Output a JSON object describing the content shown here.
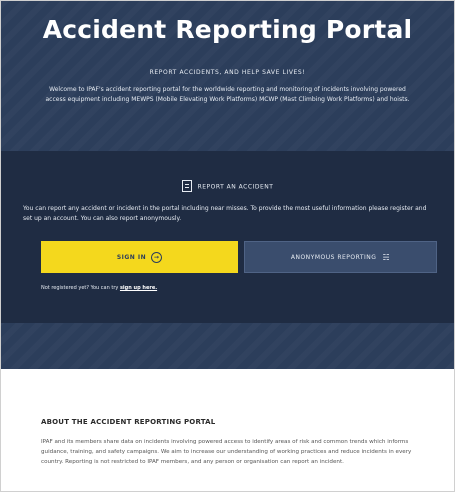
{
  "hero": {
    "title": "Accident Reporting Portal",
    "tagline": "REPORT ACCIDENTS, AND HELP SAVE LIVES!",
    "intro": "Welcome to IPAF's accident reporting portal for the worldwide reporting and monitoring of incidents involving powered access equipment including MEWPS (Mobile Elevating Work Platforms) MCWP (Mast Climbing Work Platforms) and hoists."
  },
  "report": {
    "heading": "REPORT AN ACCIDENT",
    "description": "You can report any accident or incident in the portal including near misses. To provide the most useful information please register and set up an account. You can also report anonymously.",
    "signin_label": "SIGN IN",
    "anonymous_label": "ANONYMOUS REPORTING",
    "register_prefix": "Not registered yet? You can try",
    "register_link": "sign up here."
  },
  "about": {
    "heading": "ABOUT THE ACCIDENT REPORTING PORTAL",
    "body": "IPAF and its members share data on incidents involving powered access to identify areas of risk and common trends which informs guidance, training, and safety campaigns. We aim to increase our understanding of working practices and reduce incidents in every country. Reporting is not restricted to IPAF members, and any person or organisation can report an incident."
  },
  "icons": {
    "report": "document-icon",
    "signin": "sign-in-arrow-icon",
    "anonymous": "incognito-icon"
  },
  "colors": {
    "hero_bg": "#2c3e5b",
    "panel_bg": "#1f2c43",
    "signin_button": "#f4d81d",
    "anonymous_button": "#3a4d6d"
  }
}
